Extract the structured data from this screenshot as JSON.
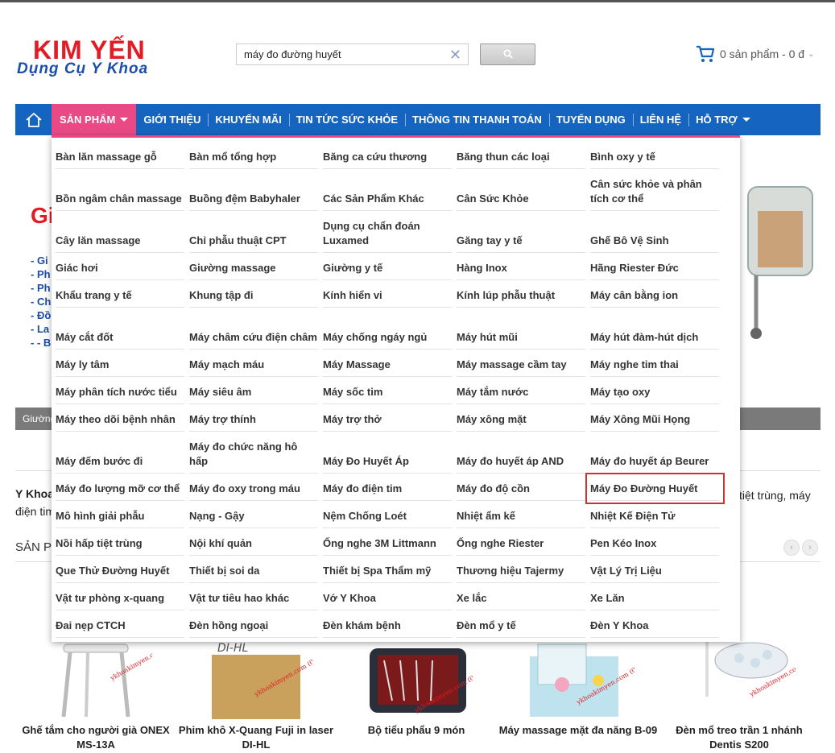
{
  "header": {
    "logo_line1": "KIM YẾN",
    "logo_line2": "Dụng Cụ Y Khoa",
    "search_value": "máy đo đường huyết",
    "clear_symbol": "✕",
    "cart_text": "0 sản phẩm - 0 đ",
    "cart_chevron": "⌄"
  },
  "nav": {
    "items": [
      "SẢN PHẨM",
      "GIỚI THIỆU",
      "KHUYẾN MÃI",
      "TIN TỨC SỨC KHỎE",
      "THÔNG TIN THANH TOÁN",
      "TUYỂN DỤNG",
      "LIÊN HỆ",
      "HỖ TRỢ"
    ]
  },
  "background": {
    "slide_title": "Gi",
    "bullets": [
      "- Gi",
      "- Ph",
      "- Ph",
      "- Ch",
      "- Đồ",
      "- La",
      "- - B"
    ],
    "bar_text": "Giường",
    "intro_left": "Y Khoa",
    "intro_right": "tiệt trùng, máy",
    "intro_line2": "điện tim",
    "section_title": "SẢN PH",
    "arrow_prev": "‹",
    "arrow_next": "›"
  },
  "menu": {
    "columns": [
      [
        "Bàn lăn massage gỗ",
        "Bồn ngâm chân massage",
        "Cây lăn massage",
        "Giác hơi",
        "Khẩu trang y tế",
        "Máy cắt đốt",
        "Máy ly tâm",
        "Máy phân tích nước tiểu",
        "Máy theo dõi bệnh nhân",
        "Máy đếm bước đi",
        "Máy đo lượng mỡ cơ thể",
        "Mô hình giải phẫu",
        "Nồi hấp tiệt trùng",
        "Que Thử Đường Huyết",
        "Vật tư phòng x-quang",
        "Đai nẹp CTCH"
      ],
      [
        "Bàn mổ tổng hợp",
        "Buồng đệm Babyhaler",
        "Chỉ phẫu thuật CPT",
        "Giường massage",
        "Khung tập đi",
        "Máy châm cứu điện châm",
        "Máy mạch máu",
        "Máy siêu âm",
        "Máy trợ thính",
        "Máy đo chức năng hô hấp",
        "Máy đo oxy trong máu",
        "Nạng - Gậy",
        "Nội khí quản",
        "Thiết bị soi da",
        "Vật tư tiêu hao khác",
        "Đèn hồng ngoại"
      ],
      [
        "Băng ca cứu thương",
        "Các Sản Phẩm Khác",
        "Dụng cụ chẩn đoán Luxamed",
        "Giường y tế",
        "Kính hiển vi",
        "Máy chống ngáy ngủ",
        "Máy Massage",
        "Máy sốc tim",
        "Máy trợ thở",
        "Máy Đo Huyết Áp",
        "Máy đo điện tim",
        "Nệm Chống Loét",
        "Ống nghe 3M Littmann",
        "Thiết bị Spa Thẩm mỹ",
        "Vớ Y Khoa",
        "Đèn khám bệnh"
      ],
      [
        "Băng thun các loại",
        "Cân Sức Khỏe",
        "Găng tay y tế",
        "Hàng Inox",
        "Kính lúp phẫu thuật",
        "Máy hút mũi",
        "Máy massage cầm tay",
        "Máy tắm nước",
        "Máy xông mặt",
        "Máy đo huyết áp AND",
        "Máy đo độ cồn",
        "Nhiệt ẩm kế",
        "Ống nghe Riester",
        "Thương hiệu Tajermy",
        "Xe lắc",
        "Đèn mổ y tế"
      ],
      [
        "Bình oxy y tế",
        "Cân sức khỏe và phân tích cơ thể",
        "Ghế Bô Vệ Sinh",
        "Hãng Riester Đức",
        "Máy cân bằng ion",
        "Máy hút đàm-hút dịch",
        "Máy nghe tim thai",
        "Máy tạo oxy",
        "Máy Xông Mũi Họng",
        "Máy đo huyết áp Beurer",
        "Máy Đo Đường Huyết",
        "Nhiệt Kế Điện Tử",
        "Pen Kéo Inox",
        "Vật Lý Trị Liệu",
        "Xe Lăn",
        "Đèn Y Khoa"
      ]
    ]
  },
  "products": [
    {
      "name": "Ghế tắm cho người già ONEX MS-13A"
    },
    {
      "name": "Phim khô X-Quang Fuji in laser DI-HL"
    },
    {
      "name": "Bộ tiểu phẩu 9 món"
    },
    {
      "name": "Máy massage mặt đa năng B-09"
    },
    {
      "name": "Đèn mổ treo trần 1 nhánh Dentis S200"
    }
  ],
  "product_watermark": "ykhoakimyen.com (028) 3862 1063",
  "film_label": "DI-HL"
}
